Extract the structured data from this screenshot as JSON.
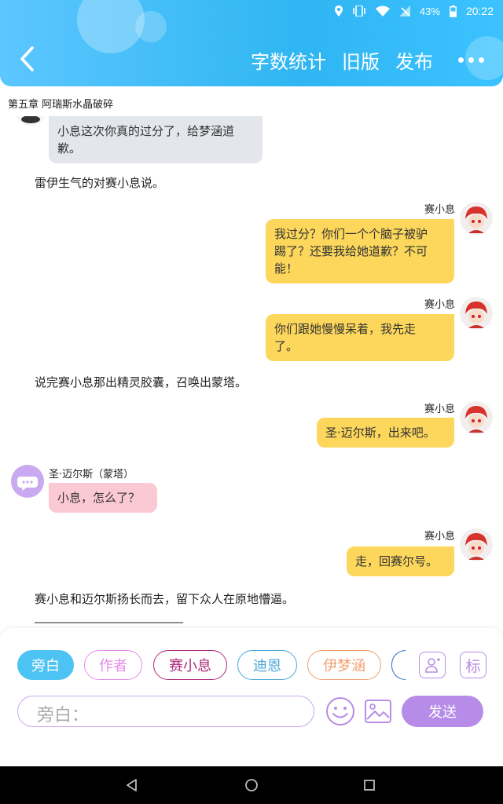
{
  "status_bar": {
    "battery": "43%",
    "time": "20:22"
  },
  "header": {
    "actions": [
      "字数统计",
      "旧版",
      "发布"
    ],
    "colors": {
      "primary": "#2fb6f2"
    }
  },
  "chapter_title": "第五章 阿瑞斯水晶破碎",
  "messages": [
    {
      "type": "left_gray_partial",
      "text_lines": [
        "小息这次你真的过分了，给梦涵道",
        "歉。"
      ]
    },
    {
      "type": "narration",
      "text": "雷伊生气的对赛小息说。"
    },
    {
      "type": "right",
      "name": "赛小息",
      "text_lines": [
        "我过分？你们一个个脑子被驴",
        "踢了？还要我给她道歉？不可",
        "能！"
      ]
    },
    {
      "type": "right",
      "name": "赛小息",
      "text_lines": [
        "你们跟她慢慢呆着，我先走",
        "了。"
      ]
    },
    {
      "type": "narration",
      "text": "说完赛小息那出精灵胶囊，召唤出蒙塔。"
    },
    {
      "type": "right",
      "name": "赛小息",
      "text_lines": [
        "圣·迈尔斯，出来吧。"
      ]
    },
    {
      "type": "left",
      "name": "圣·迈尔斯（蒙塔）",
      "text_lines": [
        "小息，怎么了？"
      ]
    },
    {
      "type": "right",
      "name": "赛小息",
      "text_lines": [
        "走，回赛尔号。"
      ]
    },
    {
      "type": "narration",
      "text": "赛小息和迈尔斯扬长而去，留下众人在原地懵逼。"
    },
    {
      "type": "narration",
      "text": "___________________________"
    }
  ],
  "roles": [
    {
      "label": "旁白",
      "color": "#4cc3f2",
      "selected": true
    },
    {
      "label": "作者",
      "color": "#e58ce8",
      "selected": false
    },
    {
      "label": "赛小息",
      "color": "#b0287a",
      "selected": false
    },
    {
      "label": "迪恩",
      "color": "#4aa8d8",
      "selected": false
    },
    {
      "label": "伊梦涵",
      "color": "#f0a070",
      "selected": false
    }
  ],
  "tag_icon_label": "标",
  "input": {
    "label": "旁白：",
    "value": ""
  },
  "send_label": "发送",
  "icons": [
    "back-chevron-icon",
    "more-icon",
    "location-icon",
    "vibrate-icon",
    "wifi-icon",
    "no-sim-icon",
    "battery-icon",
    "add-role-icon",
    "tag-icon",
    "emoji-icon",
    "image-icon",
    "nav-back-icon",
    "nav-home-icon",
    "nav-recents-icon"
  ]
}
